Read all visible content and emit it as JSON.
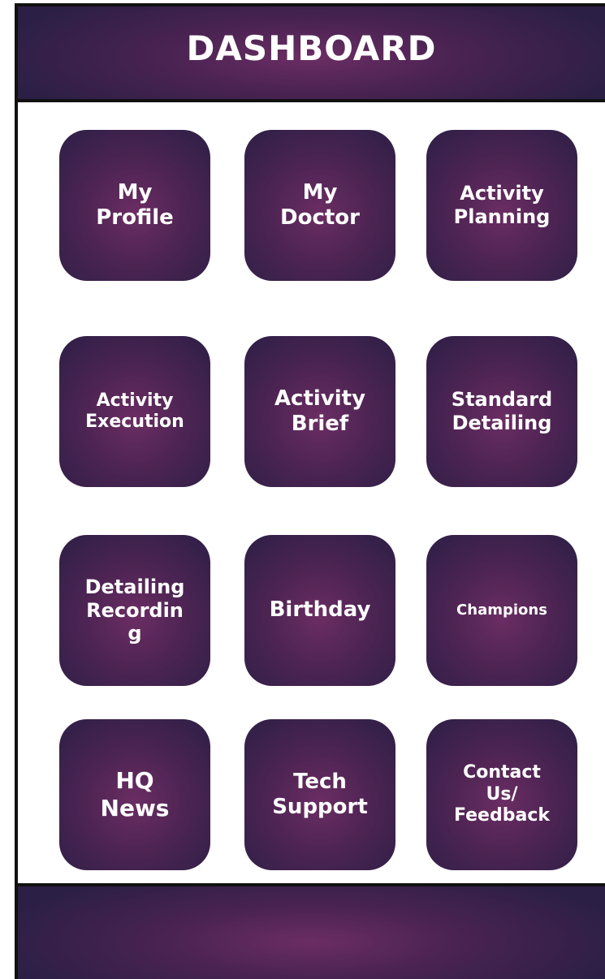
{
  "header": {
    "title": "DASHBOARD"
  },
  "tiles": [
    {
      "label": "My\nProfile"
    },
    {
      "label": "My\nDoctor"
    },
    {
      "label": "Activity\nPlanning"
    },
    {
      "label": "Activity\nExecution"
    },
    {
      "label": "Activity\nBrief"
    },
    {
      "label": "Standard\nDetailing"
    },
    {
      "label": "Detailing\nRecordin\ng"
    },
    {
      "label": "Birthday"
    },
    {
      "label": "Champions"
    },
    {
      "label": "HQ\nNews"
    },
    {
      "label": "Tech\nSupport"
    },
    {
      "label": "Contact\nUs/\nFeedback"
    }
  ],
  "colors": {
    "tile_center": "#6b2d63",
    "tile_edge": "#2c1f45",
    "text": "#ffffff",
    "border": "#111111"
  }
}
